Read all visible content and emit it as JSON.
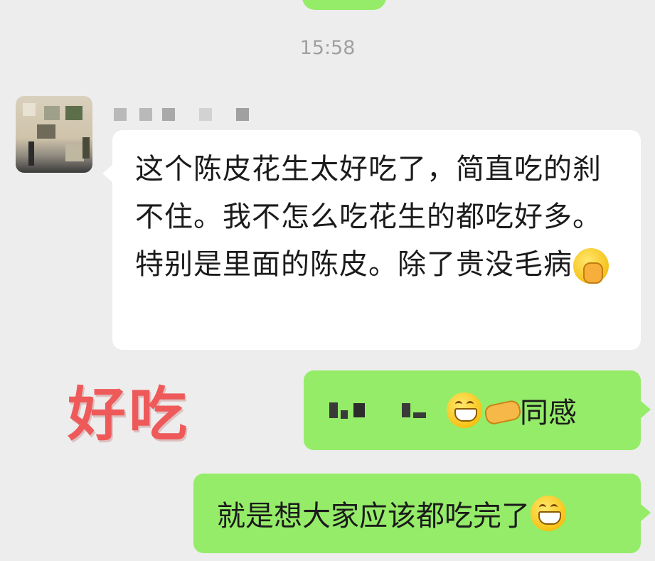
{
  "chat": {
    "timestamp": "15:58",
    "incoming": {
      "text": "这个陈皮花生太好吃了，简直吃的刹不住。我不怎么吃花生的都吃好多。特别是里面的陈皮。除了贵没毛病",
      "trailing_emoji": "shy-emoji"
    },
    "outgoing": [
      {
        "text": "同感",
        "emojis": [
          "grin-emoji",
          "handshake-emoji"
        ]
      },
      {
        "text": "就是想大家应该都吃完了",
        "emojis": [
          "grin-emoji"
        ]
      }
    ],
    "annotation": "好吃"
  },
  "colors": {
    "background": "#ededed",
    "incoming_bubble": "#ffffff",
    "outgoing_bubble": "#95ec69",
    "timestamp": "#a0a0a0",
    "annotation": "#ee5a5a"
  }
}
